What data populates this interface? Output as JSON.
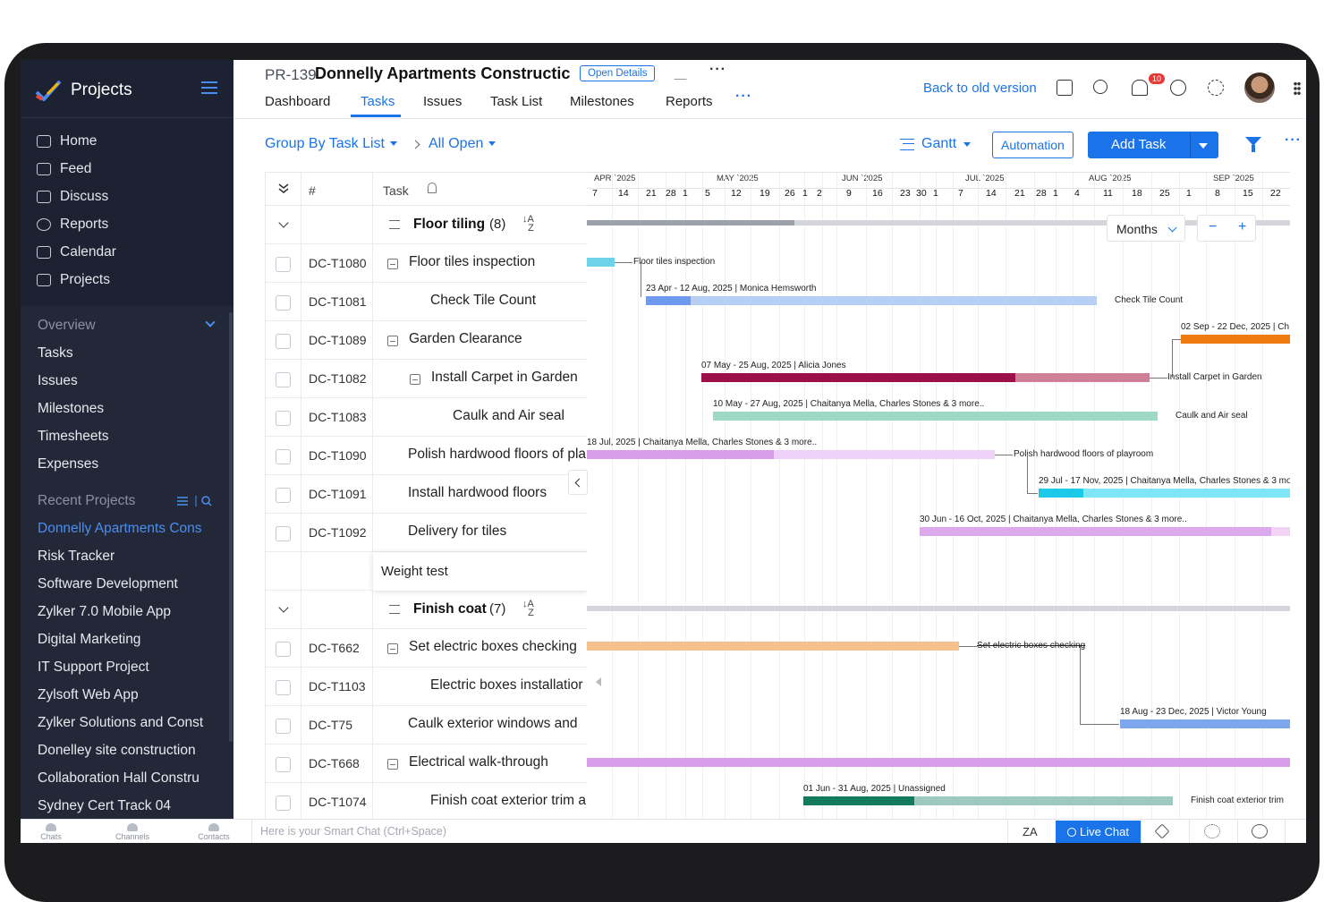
{
  "sidebar": {
    "app_title": "Projects",
    "nav": [
      "Home",
      "Feed",
      "Discuss",
      "Reports",
      "Calendar",
      "Projects"
    ],
    "overview_title": "Overview",
    "overview_items": [
      "Tasks",
      "Issues",
      "Milestones",
      "Timesheets",
      "Expenses"
    ],
    "recent_title": "Recent Projects",
    "recent_items": [
      "Donnelly Apartments Cons",
      "Risk Tracker",
      "Software Development",
      "Zylker 7.0 Mobile App",
      "Digital Marketing",
      "IT Support Project",
      "Zylsoft Web App",
      "Zylker Solutions and Const",
      "Donelley site construction",
      "Collaboration Hall Constru",
      "Sydney Cert Track 04"
    ],
    "accent": "#4a8df0"
  },
  "header": {
    "project_id": "PR-139",
    "project_name": "Donnelly Apartments Constructic",
    "open_details": "Open Details",
    "tabs": [
      "Dashboard",
      "Tasks",
      "Issues",
      "Task List",
      "Milestones",
      "Reports"
    ],
    "active_tab": "Tasks",
    "back_old": "Back to old version",
    "notification_count": "10"
  },
  "toolbar": {
    "group_by": "Group By Task List",
    "filter_view": "All Open",
    "view_mode": "Gantt",
    "automation": "Automation",
    "add_task": "Add Task"
  },
  "grid": {
    "col_hash": "#",
    "col_task": "Task",
    "groups": [
      {
        "name": "Floor tiling",
        "count": "(8)"
      },
      {
        "name": "Finish coat",
        "count": "(7)"
      }
    ],
    "rows_group1": [
      {
        "id": "DC-T1080",
        "name": "Floor tiles inspection"
      },
      {
        "id": "DC-T1081",
        "name": "Check Tile Count"
      },
      {
        "id": "DC-T1089",
        "name": "Garden Clearance"
      },
      {
        "id": "DC-T1082",
        "name": "Install Carpet in Garden"
      },
      {
        "id": "DC-T1083",
        "name": "Caulk and Air seal"
      },
      {
        "id": "DC-T1090",
        "name": "Polish hardwood floors of pla"
      },
      {
        "id": "DC-T1091",
        "name": "Install hardwood floors"
      },
      {
        "id": "DC-T1092",
        "name": "Delivery for tiles"
      }
    ],
    "new_task": "Weight test",
    "rows_group2": [
      {
        "id": "DC-T662",
        "name": "Set electric boxes checking"
      },
      {
        "id": "DC-T1103",
        "name": "Electric boxes installatior"
      },
      {
        "id": "DC-T75",
        "name": "Caulk exterior windows and"
      },
      {
        "id": "DC-T668",
        "name": "Electrical walk-through"
      },
      {
        "id": "DC-T1074",
        "name": "Finish coat exterior trim a"
      }
    ]
  },
  "gantt": {
    "months": [
      "APR `2025",
      "MAY `2025",
      "JUN `2025",
      "JUL `2025",
      "AUG `2025",
      "SEP `2025"
    ],
    "days": [
      "7",
      "14",
      "21",
      "28",
      "1",
      "5",
      "12",
      "19",
      "26",
      "1",
      "2",
      "9",
      "16",
      "23",
      "30",
      "1",
      "7",
      "14",
      "21",
      "28",
      "1",
      "4",
      "11",
      "18",
      "25",
      "1",
      "8",
      "15",
      "22"
    ],
    "zoom_level": "Months",
    "zoom_out": "−",
    "zoom_in": "+",
    "labels": {
      "floor_tiles": "Floor tiles inspection",
      "check_tile_info": "23 Apr - 12 Aug, 2025 | Monica Hemsworth",
      "check_tile": "Check Tile Count",
      "garden_info": "02 Sep - 22 Dec, 2025 | Ch",
      "carpet_info": "07 May - 25 Aug, 2025 | Alicia Jones",
      "carpet": "Install Carpet in Garden",
      "caulk_info": "10 May - 27 Aug, 2025 | Chaitanya Mella, Charles Stones & 3 more..",
      "caulk": "Caulk and Air seal",
      "polish_info": "18 Jul, 2025 | Chaitanya Mella, Charles Stones & 3 more..",
      "polish": "Polish hardwood floors of playroom",
      "install_info": "29 Jul - 17 Nov, 2025 | Chaitanya Mella, Charles Stones & 3 mo",
      "delivery_info": "30 Jun - 16 Oct, 2025 | Chaitanya Mella, Charles Stones & 3 more..",
      "electric": "Set electric boxes checking",
      "caulk_ext_info": "18 Aug - 23 Dec, 2025 | Victor Young",
      "finish_info": "01 Jun - 31 Aug, 2025 | Unassigned",
      "finish": "Finish coat exterior trim"
    }
  },
  "bottombar": {
    "chats": "Chats",
    "channels": "Channels",
    "contacts": "Contacts",
    "smart_chat": "Here is your Smart Chat (Ctrl+Space)",
    "live_chat": "Live Chat"
  }
}
